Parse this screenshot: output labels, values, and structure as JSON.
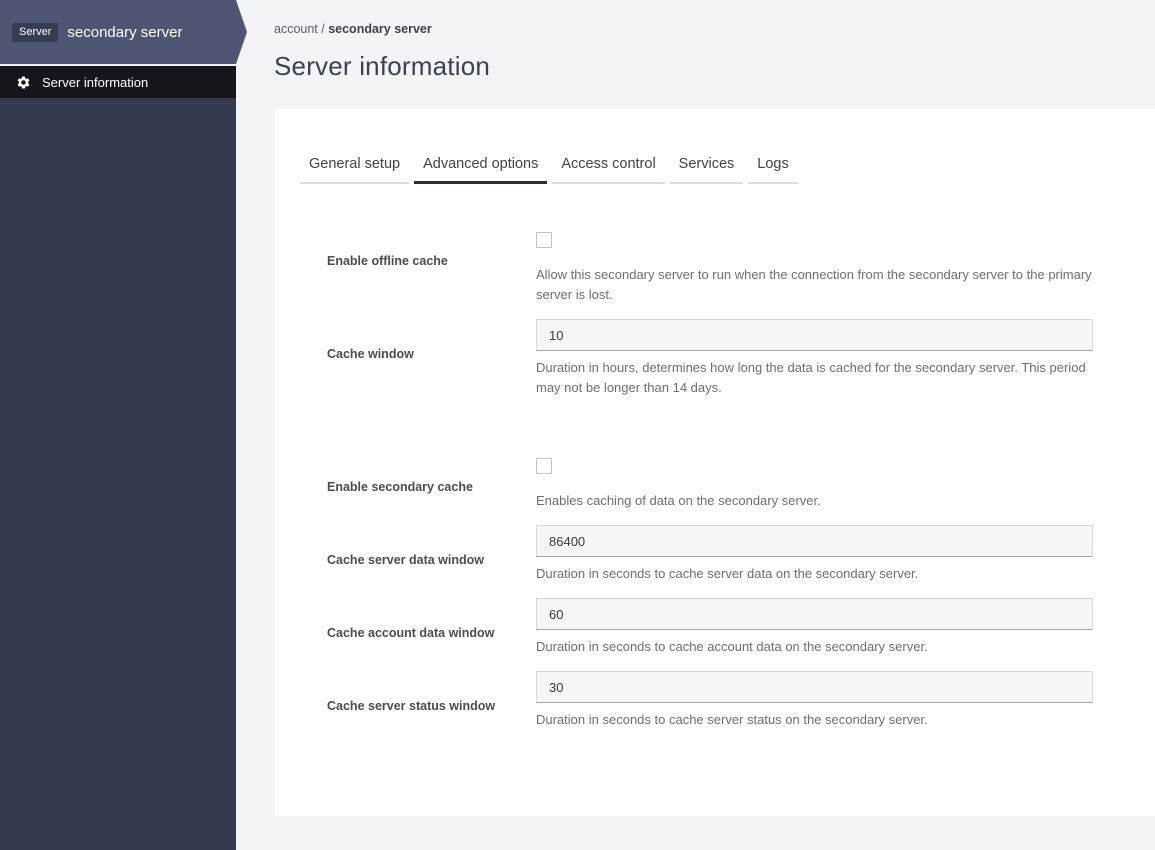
{
  "sidebar": {
    "badge": "Server",
    "server_name": "secondary server",
    "nav": [
      {
        "icon": "gear-icon",
        "label": "Server information"
      }
    ]
  },
  "breadcrumb": {
    "parent": "account",
    "separator": " / ",
    "current": "secondary server"
  },
  "page": {
    "title": "Server information"
  },
  "tabs": [
    {
      "label": "General setup",
      "active": false
    },
    {
      "label": "Advanced options",
      "active": true
    },
    {
      "label": "Access control",
      "active": false
    },
    {
      "label": "Services",
      "active": false
    },
    {
      "label": "Logs",
      "active": false
    }
  ],
  "form": {
    "fields": [
      {
        "type": "checkbox",
        "label": "Enable offline cache",
        "checked": false,
        "help": "Allow this secondary server to run when the connection from the secondary server to the primary server is lost."
      },
      {
        "type": "text",
        "label": "Cache window",
        "value": "10",
        "help": "Duration in hours, determines how long the data is cached for the secondary server. This period may not be longer than 14 days."
      },
      {
        "type": "checkbox",
        "label": "Enable secondary cache",
        "checked": false,
        "help": "Enables caching of data on the secondary server."
      },
      {
        "type": "text",
        "label": "Cache server data window",
        "value": "86400",
        "help": "Duration in seconds to cache server data on the secondary server."
      },
      {
        "type": "text",
        "label": "Cache account data window",
        "value": "60",
        "help": "Duration in seconds to cache account data on the secondary server."
      },
      {
        "type": "text",
        "label": "Cache server status window",
        "value": "30",
        "help": "Duration in seconds to cache server status on the secondary server."
      }
    ]
  },
  "colors": {
    "sidebar_header": "#4d5572",
    "sidebar_body": "#343b4f",
    "sidebar_nav_bar": "#14161b",
    "active_tab_underline": "#272e41",
    "card_background": "#ffffff",
    "page_background": "#f3f4f7",
    "input_background": "#f6f6f8"
  }
}
